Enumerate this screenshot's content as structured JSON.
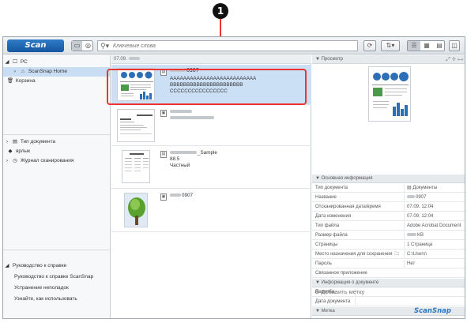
{
  "callout": "1",
  "toolbar": {
    "scan_label": "Scan",
    "search_placeholder": "Ключевые слова",
    "search_icon": "search-icon",
    "refresh_icon": "refresh-icon",
    "sort_icon": "sort-icon"
  },
  "sidebar": {
    "pc": "PC",
    "scansnap_home": "ScanSnap Home",
    "trash": "Корзина",
    "doc_type": "Тип документа",
    "tag": "ярлык",
    "scan_log": "Журнал сканирования",
    "help_guide": "Руководство к справке",
    "help_guide_sub": "Руководство к справке ScanSnap",
    "troubleshoot": "Устранение неполадок",
    "how_to": "Узнайте, как использовать"
  },
  "list": {
    "date_header": "07.09.",
    "cards": [
      {
        "title_suffix": "0907",
        "lines": [
          "AAAAAAAAAAAAAAAAAAAAAAAAAA",
          "BBBBBBBBBBBBBBBBBBBBBB",
          "CCCCCCCCCCCCCCCC"
        ],
        "selected": true
      },
      {
        "title_suffix": "",
        "lines": [],
        "selected": false
      },
      {
        "title_suffix": "_Sample",
        "lines": [
          "88.5",
          "Частный"
        ],
        "selected": false
      },
      {
        "title_suffix": "0907",
        "lines": [],
        "selected": false
      }
    ]
  },
  "preview": {
    "header": "Просмотр",
    "basic_header": "Основная информация",
    "rows": [
      {
        "k": "Тип документа",
        "v": "Документы"
      },
      {
        "k": "Название",
        "v": "0907"
      },
      {
        "k": "Отсканированная дата/время",
        "v": "07.09.      12:04"
      },
      {
        "k": "Дата изменения",
        "v": "07.09.      12:04"
      },
      {
        "k": "Тип файла",
        "v": "Adobe Acrobat Document"
      },
      {
        "k": "Размер файла",
        "v": "KB"
      },
      {
        "k": "Страницы",
        "v": "1 Страница"
      },
      {
        "k": "Место назначения для сохранения",
        "v": "C:\\Users\\"
      },
      {
        "k": "Пароль",
        "v": "Нет"
      },
      {
        "k": "Связанное приложение",
        "v": ""
      }
    ],
    "docinfo_header": "Информация о документе",
    "docinfo_rows": [
      {
        "k": "Памятка",
        "v": ""
      },
      {
        "k": "Дата документа",
        "v": ""
      }
    ],
    "tag_header": "Метка",
    "add_tag": "Добавить метку"
  },
  "brand": "ScanSnap"
}
